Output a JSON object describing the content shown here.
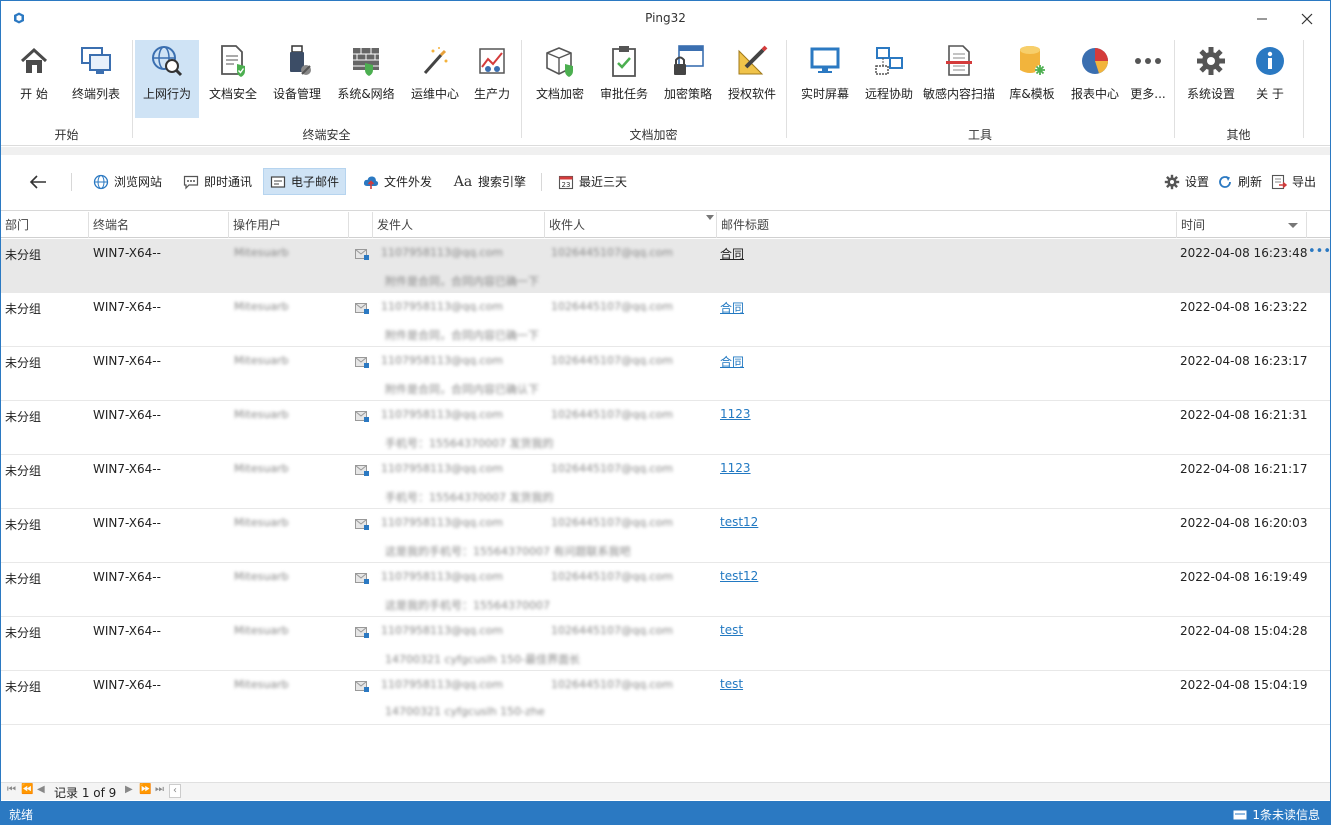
{
  "window": {
    "title": "Ping32"
  },
  "ribbon": {
    "buttons": [
      {
        "label": "开 始"
      },
      {
        "label": "终端列表"
      },
      {
        "label": "上网行为"
      },
      {
        "label": "文档安全"
      },
      {
        "label": "设备管理"
      },
      {
        "label": "系统&网络"
      },
      {
        "label": "运维中心"
      },
      {
        "label": "生产力"
      },
      {
        "label": "文档加密"
      },
      {
        "label": "审批任务"
      },
      {
        "label": "加密策略"
      },
      {
        "label": "授权软件"
      },
      {
        "label": "实时屏幕"
      },
      {
        "label": "远程协助"
      },
      {
        "label": "敏感内容扫描"
      },
      {
        "label": "库&模板"
      },
      {
        "label": "报表中心"
      },
      {
        "label": "更多..."
      },
      {
        "label": "系统设置"
      },
      {
        "label": "关 于"
      }
    ],
    "groups": [
      "开始",
      "终端安全",
      "文档加密",
      "工具",
      "其他"
    ]
  },
  "toolbar": {
    "back": "back",
    "tabs": [
      "浏览网站",
      "即时通讯",
      "电子邮件",
      "文件外发",
      "搜索引擎",
      "最近三天"
    ],
    "right": [
      "设置",
      "刷新",
      "导出"
    ]
  },
  "grid": {
    "columns": [
      "部门",
      "终端名",
      "操作用户",
      "发件人",
      "收件人",
      "邮件标题",
      "时间"
    ],
    "rows": [
      {
        "dept": "未分组",
        "terminal": "WIN7-X64--",
        "user": "Mitesuarb",
        "from": "1107958113@qq.com",
        "body": "附件是合同，合同内容已确一下",
        "to": "1026445107@qq.com",
        "subject": "合同",
        "time": "2022-04-08 16:23:48"
      },
      {
        "dept": "未分组",
        "terminal": "WIN7-X64--",
        "user": "Mitesuarb",
        "from": "1107958113@qq.com",
        "body": "附件是合同，合同内容已确一下",
        "to": "1026445107@qq.com",
        "subject": "合同",
        "time": "2022-04-08 16:23:22"
      },
      {
        "dept": "未分组",
        "terminal": "WIN7-X64--",
        "user": "Mitesuarb",
        "from": "1107958113@qq.com",
        "body": "附件是合同，合同内容已确认下",
        "to": "1026445107@qq.com",
        "subject": "合同",
        "time": "2022-04-08 16:23:17"
      },
      {
        "dept": "未分组",
        "terminal": "WIN7-X64--",
        "user": "Mitesuarb",
        "from": "1107958113@qq.com",
        "body": "手机号：15564370007 发货我的",
        "to": "1026445107@qq.com",
        "subject": "1123",
        "time": "2022-04-08 16:21:31"
      },
      {
        "dept": "未分组",
        "terminal": "WIN7-X64--",
        "user": "Mitesuarb",
        "from": "1107958113@qq.com",
        "body": "手机号：15564370007 发货我的",
        "to": "1026445107@qq.com",
        "subject": "1123",
        "time": "2022-04-08 16:21:17"
      },
      {
        "dept": "未分组",
        "terminal": "WIN7-X64--",
        "user": "Mitesuarb",
        "from": "1107958113@qq.com",
        "body": "这是我的手机号：15564370007 有问题联系我吧",
        "to": "1026445107@qq.com",
        "subject": "test12",
        "time": "2022-04-08 16:20:03"
      },
      {
        "dept": "未分组",
        "terminal": "WIN7-X64--",
        "user": "Mitesuarb",
        "from": "1107958113@qq.com",
        "body": "这是我的手机号：15564370007",
        "to": "1026445107@qq.com",
        "subject": "test12",
        "time": "2022-04-08 16:19:49"
      },
      {
        "dept": "未分组",
        "terminal": "WIN7-X64--",
        "user": "Mitesuarb",
        "from": "1107958113@qq.com",
        "body": "14700321 cyfgcuslh 150-最佳界面长",
        "to": "1026445107@qq.com",
        "subject": "test",
        "time": "2022-04-08 15:04:28"
      },
      {
        "dept": "未分组",
        "terminal": "WIN7-X64--",
        "user": "Mitesuarb",
        "from": "1107958113@qq.com",
        "body": "14700321 cyfgcuslh 150-zhe",
        "to": "1026445107@qq.com",
        "subject": "test",
        "time": "2022-04-08 15:04:19"
      }
    ],
    "row_menu": "•••"
  },
  "pager": {
    "record": "记录 1 of 9"
  },
  "status": {
    "left": "就绪",
    "right": "1条未读信息"
  },
  "colors": {
    "accent": "#2b79c2",
    "selected": "#cfe3f5",
    "link": "#2279c2"
  }
}
